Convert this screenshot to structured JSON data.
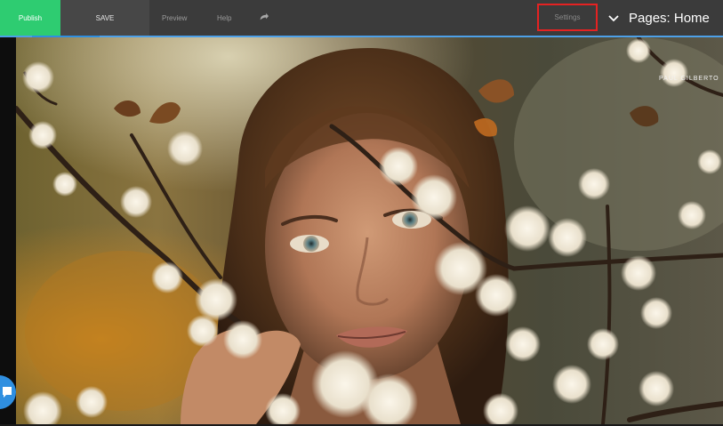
{
  "toolbar": {
    "publish_label": "Publish",
    "save_label": "SAVE",
    "preview_label": "Preview",
    "help_label": "Help",
    "undo_icon": "undo-arrow-icon",
    "settings_label": "Settings",
    "pages_label": "Pages: Home",
    "chevron_icon": "chevron-down-icon"
  },
  "canvas": {
    "watermark": "PAUL GILBERTO"
  },
  "colors": {
    "publish": "#2ecc71",
    "accent": "#2f8fe0",
    "settings_outline": "#e52222",
    "topbar": "#3b3b3b"
  }
}
